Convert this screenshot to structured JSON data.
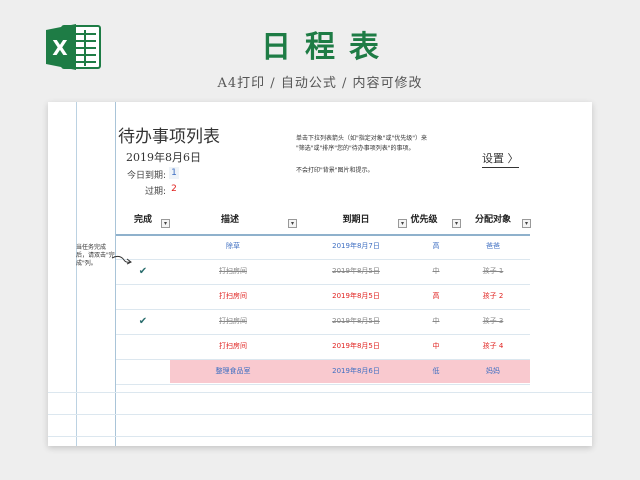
{
  "banner": {
    "logo_letter": "X",
    "title": "日程表",
    "subtitle": "A4打印 / 自动公式 / 内容可修改",
    "brand_color": "#1e7c45",
    "logo_icon": "excel-icon"
  },
  "sheet": {
    "title": "待办事项列表",
    "date": "2019年8月6日",
    "due_today_label": "今日到期:",
    "due_today_value": "1",
    "overdue_label": "过期:",
    "overdue_value": "2",
    "hint_lines": [
      "单击下拉列表箭头（如\"指定对象\"或\"优先级\"）来",
      "\"筛选\"或\"排序\"您的\"待办事项列表\"的事项。",
      "不会打印\"背景\"图片和提示。"
    ],
    "settings_label": "设置 〉",
    "side_note": "当任务完成后，请双击\"完成\"列。"
  },
  "table": {
    "columns": [
      "完成",
      "描述",
      "到期日",
      "优先级",
      "分配对象"
    ],
    "filter_icon": "dropdown-arrow-icon",
    "rows": [
      {
        "done": false,
        "check": "",
        "description": "除草",
        "due": "2019年8月7日",
        "priority": "高",
        "assignee": "爸爸",
        "style": "blue",
        "highlight": false
      },
      {
        "done": true,
        "check": "✔",
        "description": "打扫房间",
        "due": "2019年8月5日",
        "priority": "中",
        "assignee": "孩子 1",
        "style": "done",
        "highlight": false
      },
      {
        "done": false,
        "check": "",
        "description": "打扫房间",
        "due": "2019年8月5日",
        "priority": "高",
        "assignee": "孩子 2",
        "style": "red",
        "highlight": false
      },
      {
        "done": true,
        "check": "✔",
        "description": "打扫房间",
        "due": "2019年8月5日",
        "priority": "中",
        "assignee": "孩子 3",
        "style": "done",
        "highlight": false
      },
      {
        "done": false,
        "check": "",
        "description": "打扫房间",
        "due": "2019年8月5日",
        "priority": "中",
        "assignee": "孩子 4",
        "style": "red",
        "highlight": false
      },
      {
        "done": false,
        "check": "",
        "description": "整理食品室",
        "due": "2019年8月6日",
        "priority": "低",
        "assignee": "妈妈",
        "style": "blue",
        "highlight": true
      }
    ],
    "colors": {
      "overdue": "#e0221f",
      "upcoming": "#3f6fc2",
      "today_highlight": "#f9c9cf",
      "done": "#888888"
    }
  }
}
